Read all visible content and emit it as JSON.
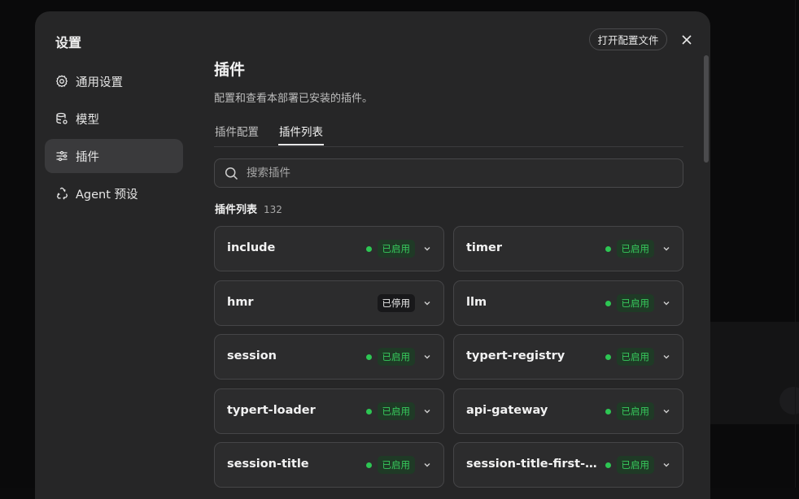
{
  "dialog": {
    "title": "设置",
    "open_config_label": "打开配置文件"
  },
  "nav": {
    "items": [
      {
        "label": "通用设置",
        "icon": "gear-icon"
      },
      {
        "label": "模型",
        "icon": "database-icon"
      },
      {
        "label": "插件",
        "icon": "sliders-icon",
        "active": true
      },
      {
        "label": "Agent 预设",
        "icon": "recycle-icon"
      }
    ]
  },
  "main": {
    "title": "插件",
    "description": "配置和查看本部署已安装的插件。",
    "tabs": [
      {
        "label": "插件配置"
      },
      {
        "label": "插件列表",
        "active": true
      }
    ],
    "search": {
      "placeholder": "搜索插件"
    },
    "list": {
      "title": "插件列表",
      "count": "132",
      "plugins": [
        {
          "name": "include",
          "status": "已启用",
          "enabled": true
        },
        {
          "name": "timer",
          "status": "已启用",
          "enabled": true
        },
        {
          "name": "hmr",
          "status": "已停用",
          "enabled": false
        },
        {
          "name": "llm",
          "status": "已启用",
          "enabled": true
        },
        {
          "name": "session",
          "status": "已启用",
          "enabled": true
        },
        {
          "name": "typert-registry",
          "status": "已启用",
          "enabled": true
        },
        {
          "name": "typert-loader",
          "status": "已启用",
          "enabled": true
        },
        {
          "name": "api-gateway",
          "status": "已启用",
          "enabled": true
        },
        {
          "name": "session-title",
          "status": "已启用",
          "enabled": true
        },
        {
          "name": "session-title-first-m...",
          "status": "已启用",
          "enabled": true
        }
      ]
    }
  },
  "colors": {
    "enabled": "#2dc653",
    "enabled_badge_bg": "#1f3a26",
    "disabled_badge_bg": "#18181a"
  }
}
